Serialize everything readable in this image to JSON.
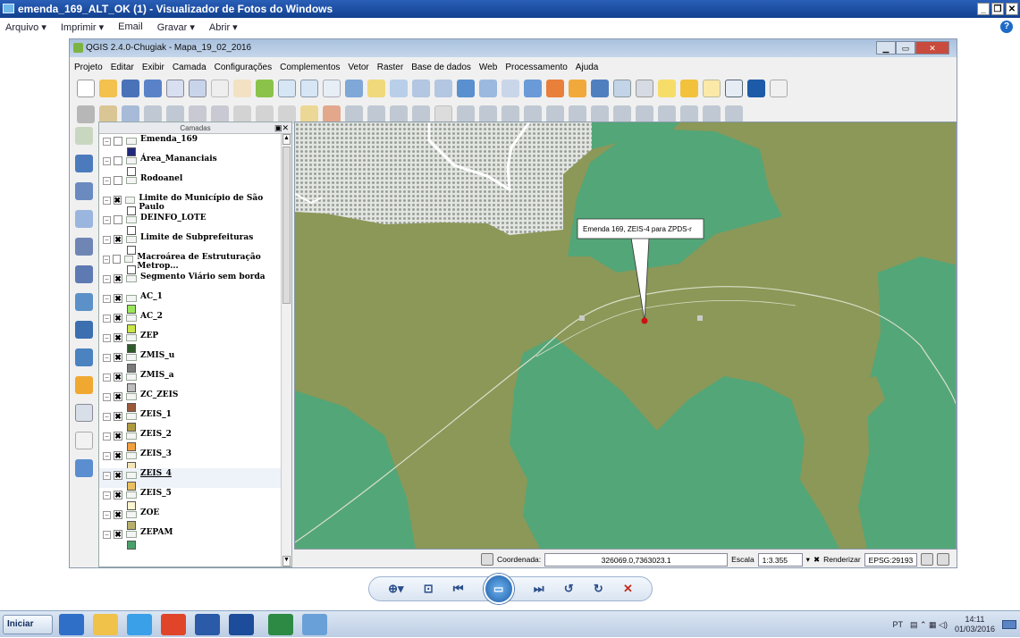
{
  "viewer": {
    "title": "emenda_169_ALT_OK (1) - Visualizador de Fotos do Windows",
    "menu": [
      "Arquivo ▾",
      "Imprimir ▾",
      "Email",
      "Gravar ▾",
      "Abrir ▾"
    ],
    "help_label": "?"
  },
  "qgis": {
    "title": "QGIS 2.4.0-Chugiak - Mapa_19_02_2016",
    "menu": [
      "Projeto",
      "Editar",
      "Exibir",
      "Camada",
      "Configurações",
      "Complementos",
      "Vetor",
      "Raster",
      "Base de dados",
      "Web",
      "Processamento",
      "Ajuda"
    ],
    "layers_panel_title": "Camadas",
    "layers": [
      {
        "name": "Emenda_169",
        "checked": false,
        "swatch": "#1f2a7a"
      },
      {
        "name": "Área_Mananciais",
        "checked": false,
        "swatch": "#ffffff"
      },
      {
        "name": "Rodoanel",
        "checked": false,
        "swatch": ""
      },
      {
        "name": "Limite do Município de São Paulo",
        "checked": true,
        "swatch": "#ffffff"
      },
      {
        "name": "DEINFO_LOTE",
        "checked": false,
        "swatch": "#ffffff"
      },
      {
        "name": "Limite de Subprefeituras",
        "checked": true,
        "swatch": "#ffffff"
      },
      {
        "name": "Macroárea de Estruturação Metrop...",
        "checked": false,
        "swatch": "#ffffff"
      },
      {
        "name": "Segmento Viário sem borda",
        "checked": true,
        "swatch": ""
      },
      {
        "name": "AC_1",
        "checked": true,
        "swatch": "#9ae65a"
      },
      {
        "name": "AC_2",
        "checked": true,
        "swatch": "#c9e64a"
      },
      {
        "name": "ZEP",
        "checked": true,
        "swatch": "#2e5a2a"
      },
      {
        "name": "ZMIS_u",
        "checked": true,
        "swatch": "#7a7a7a"
      },
      {
        "name": "ZMIS_a",
        "checked": true,
        "swatch": "#bdbdbd"
      },
      {
        "name": "ZC_ZEIS",
        "checked": true,
        "swatch": "#9a5a3a"
      },
      {
        "name": "ZEIS_1",
        "checked": true,
        "swatch": "#b09a40"
      },
      {
        "name": "ZEIS_2",
        "checked": true,
        "swatch": "#f0a040"
      },
      {
        "name": "ZEIS_3",
        "checked": true,
        "swatch": "#f5e6b8"
      },
      {
        "name": "ZEIS_4",
        "checked": true,
        "swatch": "#e8c060",
        "selected": true
      },
      {
        "name": "ZEIS_5",
        "checked": true,
        "swatch": "#fdf5d0"
      },
      {
        "name": "ZOE",
        "checked": true,
        "swatch": "#b8b06a"
      },
      {
        "name": "ZEPAM",
        "checked": true,
        "swatch": "#4aa06a"
      }
    ],
    "map": {
      "annotation": "Emenda 169, ZEIS-4 para ZPDS-r",
      "colors": {
        "green": "#53a678",
        "olive": "#8b9858",
        "gray": "#c8ccc7",
        "marker": "#cc1111"
      }
    },
    "statusbar": {
      "coord_label": "Coordenada:",
      "coord_value": "326069.0,7363023.1",
      "scale_label": "Escala",
      "scale_value": "1:3.355",
      "render_label": "Renderizar",
      "epsg": "EPSG:29193"
    }
  },
  "taskbar": {
    "start_label": "Iniciar",
    "lang": "PT",
    "time": "14:11",
    "date": "01/03/2016"
  }
}
